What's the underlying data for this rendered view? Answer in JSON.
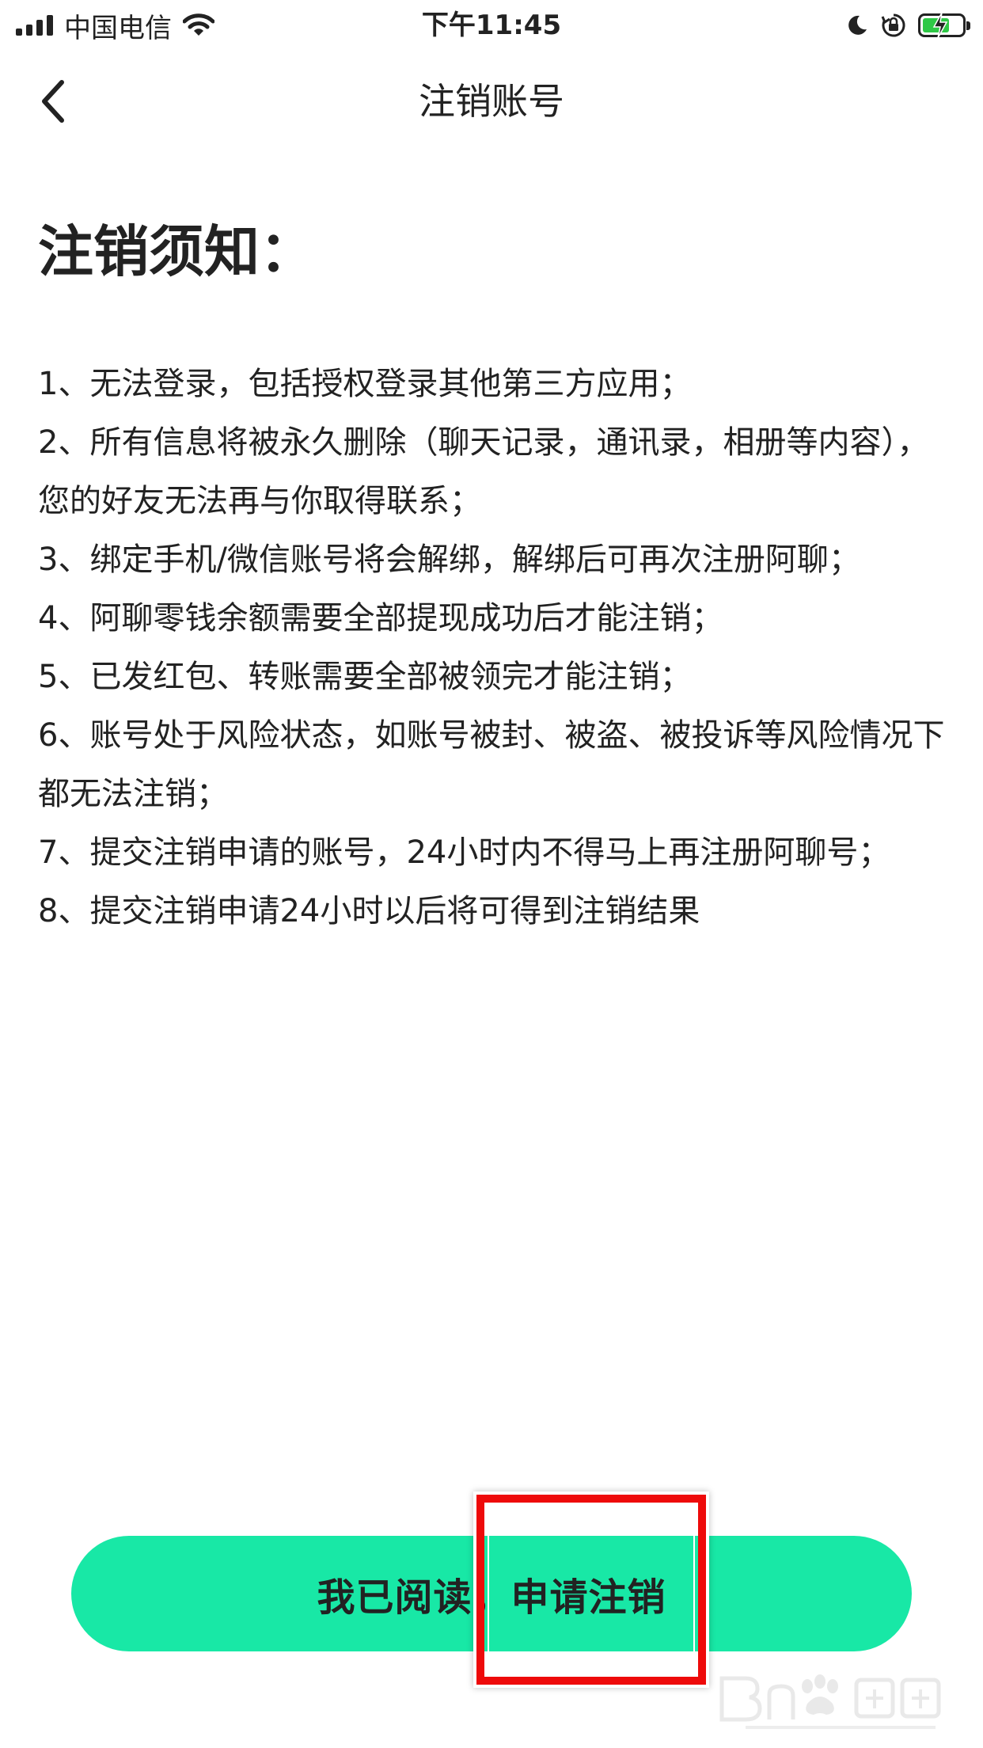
{
  "status_bar": {
    "carrier": "中国电信",
    "time": "下午11:45",
    "icons": [
      "signal-icon",
      "wifi-icon",
      "moon-icon",
      "orientation-lock-icon",
      "battery-charging-icon"
    ]
  },
  "nav": {
    "title": "注销账号",
    "back_icon": "chevron-left-icon"
  },
  "notice": {
    "heading": "注销须知：",
    "items": [
      "1、无法登录，包括授权登录其他第三方应用；",
      "2、所有信息将被永久删除（聊天记录，通讯录，相册等内容），您的好友无法再与你取得联系；",
      "3、绑定手机/微信账号将会解绑，解绑后可再次注册阿聊；",
      "4、阿聊零钱余额需要全部提现成功后才能注销；",
      "5、已发红包、转账需要全部被领完才能注销；",
      "6、账号处于风险状态，如账号被封、被盗、被投诉等风险情况下都无法注销；",
      "7、提交注销申请的账号，24小时内不得马上再注册阿聊号；",
      "8、提交注销申请24小时以后将可得到注销结果"
    ]
  },
  "action": {
    "button_label": "我已阅读，申请注销"
  },
  "colors": {
    "accent": "#18e8a6",
    "highlight": "#ee0a0a",
    "battery": "#2ec846"
  }
}
